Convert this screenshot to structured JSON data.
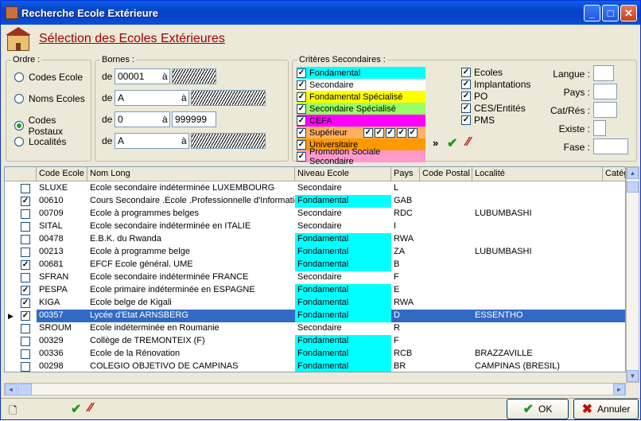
{
  "window": {
    "title": "Recherche Ecole Extérieure"
  },
  "header": {
    "title": "Sélection des Ecoles Extérieures"
  },
  "ordre": {
    "label": "Ordre :",
    "options": [
      {
        "label": "Codes Ecole",
        "selected": false
      },
      {
        "label": "Noms Ecoles",
        "selected": false
      },
      {
        "label": "Codes Postaux",
        "selected": true
      },
      {
        "label": "Localités",
        "selected": false
      }
    ]
  },
  "bornes": {
    "label": "Bornes :",
    "de": "de",
    "a": "à",
    "rows": [
      {
        "from": "00001",
        "to": ""
      },
      {
        "from": "A",
        "to": ""
      },
      {
        "from": "0",
        "to": "999999"
      },
      {
        "from": "A",
        "to": ""
      }
    ]
  },
  "criteres": {
    "label": "Critères Secondaires :",
    "items": [
      {
        "label": "Fondamental",
        "checked": true,
        "color": "#00ffff"
      },
      {
        "label": "Secondaire",
        "checked": true,
        "color": "#ffffff"
      },
      {
        "label": "Fondamental Spécialisé",
        "checked": true,
        "color": "#ffff00"
      },
      {
        "label": "Secondaire Spécialisé",
        "checked": true,
        "color": "#99ff66"
      },
      {
        "label": "CEFA",
        "checked": true,
        "color": "#ff00ff"
      },
      {
        "label": "Supérieur",
        "checked": true,
        "color": "#ffb060"
      },
      {
        "label": "Universitaire",
        "checked": true,
        "color": "#ff9900"
      },
      {
        "label": "Promotion Sociale Secondaire",
        "checked": true,
        "color": "#ff99cc"
      }
    ],
    "sup_extra": 5,
    "arrow": "»",
    "options": [
      {
        "label": "Ecoles",
        "checked": true
      },
      {
        "label": "Implantations",
        "checked": true
      },
      {
        "label": "PO",
        "checked": true
      },
      {
        "label": "CES/Entités",
        "checked": true
      },
      {
        "label": "PMS",
        "checked": true
      }
    ],
    "right_fields": [
      {
        "label": "Langue :"
      },
      {
        "label": "Pays :"
      },
      {
        "label": "Cat/Rés :"
      },
      {
        "label": "Existe :"
      },
      {
        "label": "Fase :"
      }
    ]
  },
  "table": {
    "columns": [
      "Code Ecole",
      "Nom Long",
      "Niveau Ecole",
      "Pays",
      "Code Postal",
      "Localité",
      "Catég"
    ],
    "rows": [
      {
        "checked": false,
        "code": "SLUXE",
        "nom": "Ecole secondaire indéterminée LUXEMBOURG",
        "niveau": "Secondaire",
        "pays": "L",
        "cp": "",
        "loc": "",
        "sel": false
      },
      {
        "checked": true,
        "code": "00610",
        "nom": "Cours Secondaire .Ecole .Professionnelle d'Informatiqu",
        "niveau": "Fondamental",
        "pays": "GAB",
        "cp": "",
        "loc": "",
        "sel": false
      },
      {
        "checked": false,
        "code": "00709",
        "nom": "Ecole à programmes belges",
        "niveau": "Secondaire",
        "pays": "RDC",
        "cp": "",
        "loc": "LUBUMBASHI",
        "sel": false
      },
      {
        "checked": false,
        "code": "SITAL",
        "nom": "Ecole secondaire indéterminée en ITALIE",
        "niveau": "Secondaire",
        "pays": "I",
        "cp": "",
        "loc": "",
        "sel": false
      },
      {
        "checked": false,
        "code": "00478",
        "nom": "E.B.K. du Rwanda",
        "niveau": "Fondamental",
        "pays": "RWA",
        "cp": "",
        "loc": "",
        "sel": false
      },
      {
        "checked": false,
        "code": "00213",
        "nom": "Ecole à programme belge",
        "niveau": "Fondamental",
        "pays": "ZA",
        "cp": "",
        "loc": "LUBUMBASHI",
        "sel": false
      },
      {
        "checked": true,
        "code": "00681",
        "nom": "EFCF Ecole général. UME",
        "niveau": "Fondamental",
        "pays": "B",
        "cp": "",
        "loc": "",
        "sel": false
      },
      {
        "checked": false,
        "code": "SFRAN",
        "nom": "Ecole secondaire indéterminée FRANCE",
        "niveau": "Secondaire",
        "pays": "F",
        "cp": "",
        "loc": "",
        "sel": false
      },
      {
        "checked": true,
        "code": "PESPA",
        "nom": "Ecole primaire indéterminée en ESPAGNE",
        "niveau": "Fondamental",
        "pays": "E",
        "cp": "",
        "loc": "",
        "sel": false
      },
      {
        "checked": true,
        "code": "KIGA",
        "nom": "Ecole belge de Kigali",
        "niveau": "Fondamental",
        "pays": "RWA",
        "cp": "",
        "loc": "",
        "sel": false
      },
      {
        "checked": true,
        "code": "00357",
        "nom": "Lycée d'Etat ARNSBERG",
        "niveau": "Fondamental",
        "pays": "D",
        "cp": "",
        "loc": "ESSENTHO",
        "sel": true
      },
      {
        "checked": false,
        "code": "SROUM",
        "nom": "Ecole indéterminée en Roumanie",
        "niveau": "Secondaire",
        "pays": "R",
        "cp": "",
        "loc": "",
        "sel": false
      },
      {
        "checked": false,
        "code": "00329",
        "nom": "Collège de TREMONTEIX (F)",
        "niveau": "Fondamental",
        "pays": "F",
        "cp": "",
        "loc": "",
        "sel": false
      },
      {
        "checked": false,
        "code": "00336",
        "nom": "Ecole de la Rénovation",
        "niveau": "Fondamental",
        "pays": "RCB",
        "cp": "",
        "loc": "BRAZZAVILLE",
        "sel": false
      },
      {
        "checked": false,
        "code": "00298",
        "nom": "COLEGIO OBJETIVO DE CAMPINAS",
        "niveau": "Fondamental",
        "pays": "BR",
        "cp": "",
        "loc": "CAMPINAS (BRESIL)",
        "sel": false
      }
    ]
  },
  "level_colors": {
    "Fondamental": "#00ffff",
    "Secondaire": "#ffffff"
  },
  "buttons": {
    "ok": "OK",
    "annuler": "Annuler"
  }
}
